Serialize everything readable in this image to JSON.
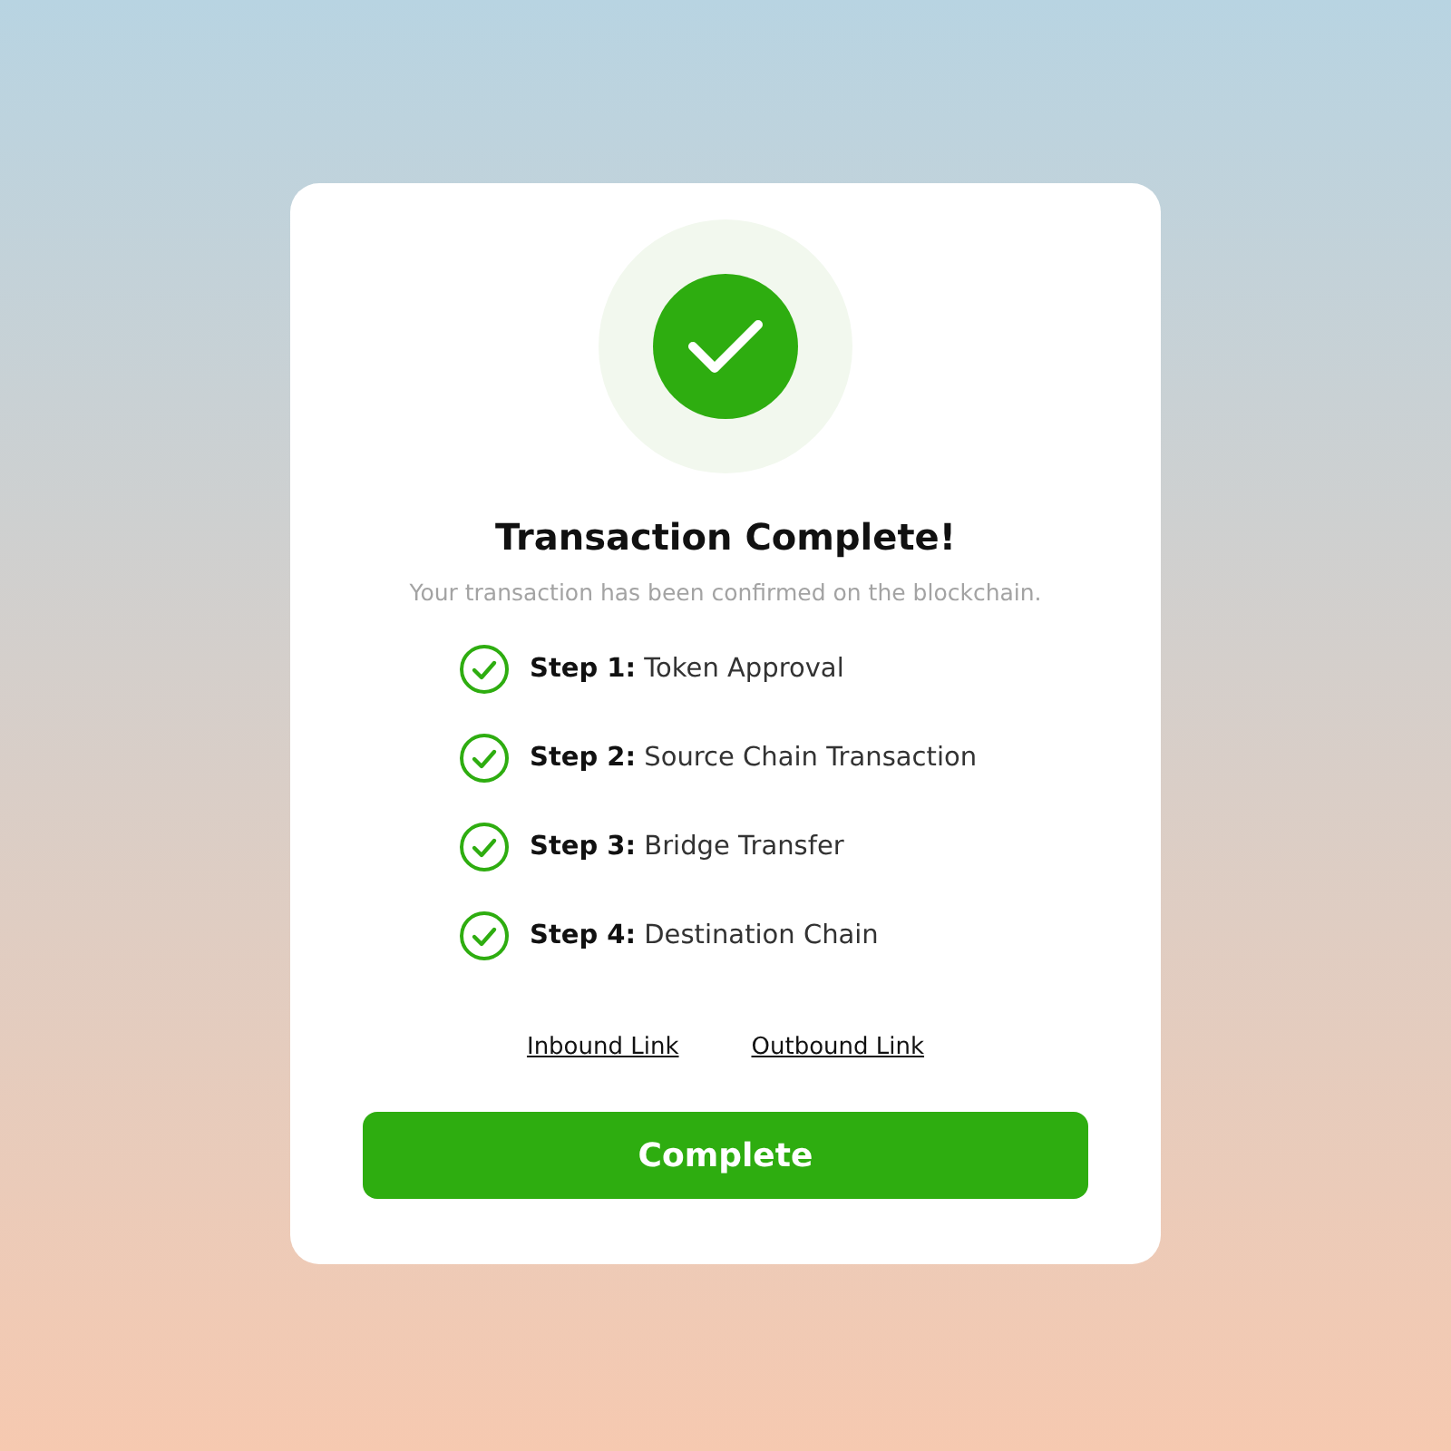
{
  "title": "Transaction Complete!",
  "subtitle": "Your transaction has been confirmed on the blockchain.",
  "steps": [
    {
      "label": "Step 1:",
      "text": "Token Approval",
      "done": true
    },
    {
      "label": "Step 2:",
      "text": "Source Chain Transaction",
      "done": true
    },
    {
      "label": "Step 3:",
      "text": "Bridge Transfer",
      "done": true
    },
    {
      "label": "Step 4:",
      "text": "Destination Chain",
      "done": true
    }
  ],
  "links": [
    "Inbound Link",
    "Outbound Link"
  ],
  "button": "Complete"
}
